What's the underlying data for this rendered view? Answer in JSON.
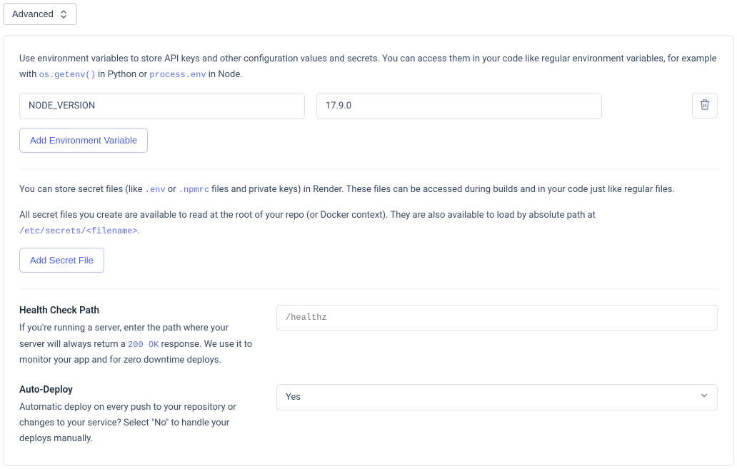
{
  "advanced_toggle": "Advanced",
  "env_help": {
    "start": "Use environment variables to store API keys and other configuration values and secrets. You can access them in your code like regular environment variables, for example with ",
    "code1": "os.getenv()",
    "mid1": " in Python or ",
    "code2": "process.env",
    "end": " in Node."
  },
  "env_var": {
    "key": "NODE_VERSION",
    "value": "17.9.0"
  },
  "add_env_button": "Add Environment Variable",
  "secrets": {
    "line1_start": "You can store secret files (like ",
    "code1": ".env",
    "line1_mid1": " or ",
    "code2": ".npmrc",
    "line1_end": " files and private keys) in Render. These files can be accessed during builds and in your code just like regular files.",
    "line2_start": "All secret files you create are available to read at the root of your repo (or Docker context). They are also available to load by absolute path at ",
    "code3": "/etc/secrets/<filename>",
    "line2_end": "."
  },
  "add_secret_button": "Add Secret File",
  "health": {
    "title": "Health Check Path",
    "desc_start": "If you're running a server, enter the path where your server will always return a ",
    "code": "200 OK",
    "desc_end": " response. We use it to monitor your app and for zero downtime deploys.",
    "placeholder": "/healthz"
  },
  "auto_deploy": {
    "title": "Auto-Deploy",
    "desc": "Automatic deploy on every push to your repository or changes to your service? Select \"No\" to handle your deploys manually.",
    "value": "Yes"
  }
}
